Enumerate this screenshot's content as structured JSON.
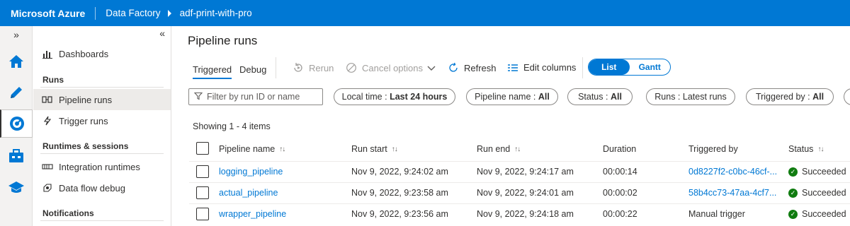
{
  "topbar": {
    "brand": "Microsoft Azure",
    "service": "Data Factory",
    "factory": "adf-print-with-pro"
  },
  "nav": {
    "dashboards": "Dashboards",
    "runs_heading": "Runs",
    "pipeline_runs": "Pipeline runs",
    "trigger_runs": "Trigger runs",
    "runtimes_heading": "Runtimes & sessions",
    "integration_runtimes": "Integration runtimes",
    "data_flow_debug": "Data flow debug",
    "notifications_heading": "Notifications"
  },
  "page": {
    "title": "Pipeline runs",
    "tabs": [
      "Triggered",
      "Debug"
    ],
    "toolbar": {
      "rerun": "Rerun",
      "cancel": "Cancel options",
      "refresh": "Refresh",
      "edit_columns": "Edit columns"
    },
    "view_toggle": {
      "list": "List",
      "gantt": "Gantt"
    },
    "filter_placeholder": "Filter by run ID or name",
    "filters": [
      {
        "label": "Local time : ",
        "value": "Last 24 hours"
      },
      {
        "label": "Pipeline name : ",
        "value": "All"
      },
      {
        "label": "Status : ",
        "value": "All"
      },
      {
        "label": "Runs : ",
        "value": "Latest runs"
      },
      {
        "label": "Triggered by : ",
        "value": "All"
      }
    ],
    "showing": "Showing 1 - 4 items"
  },
  "table": {
    "columns": [
      "Pipeline name",
      "Run start",
      "Run end",
      "Duration",
      "Triggered by",
      "Status"
    ],
    "rows": [
      {
        "name": "logging_pipeline",
        "start": "Nov 9, 2022, 9:24:02 am",
        "end": "Nov 9, 2022, 9:24:17 am",
        "duration": "00:00:14",
        "triggered_by": "0d8227f2-c0bc-46cf-...",
        "status": "Succeeded"
      },
      {
        "name": "actual_pipeline",
        "start": "Nov 9, 2022, 9:23:58 am",
        "end": "Nov 9, 2022, 9:24:01 am",
        "duration": "00:00:02",
        "triggered_by": "58b4cc73-47aa-4cf7...",
        "status": "Succeeded"
      },
      {
        "name": "wrapper_pipeline",
        "start": "Nov 9, 2022, 9:23:56 am",
        "end": "Nov 9, 2022, 9:24:18 am",
        "duration": "00:00:22",
        "triggered_by": "Manual trigger",
        "status": "Succeeded"
      }
    ]
  },
  "colors": {
    "accent": "#0078d4",
    "success": "#107c10"
  }
}
